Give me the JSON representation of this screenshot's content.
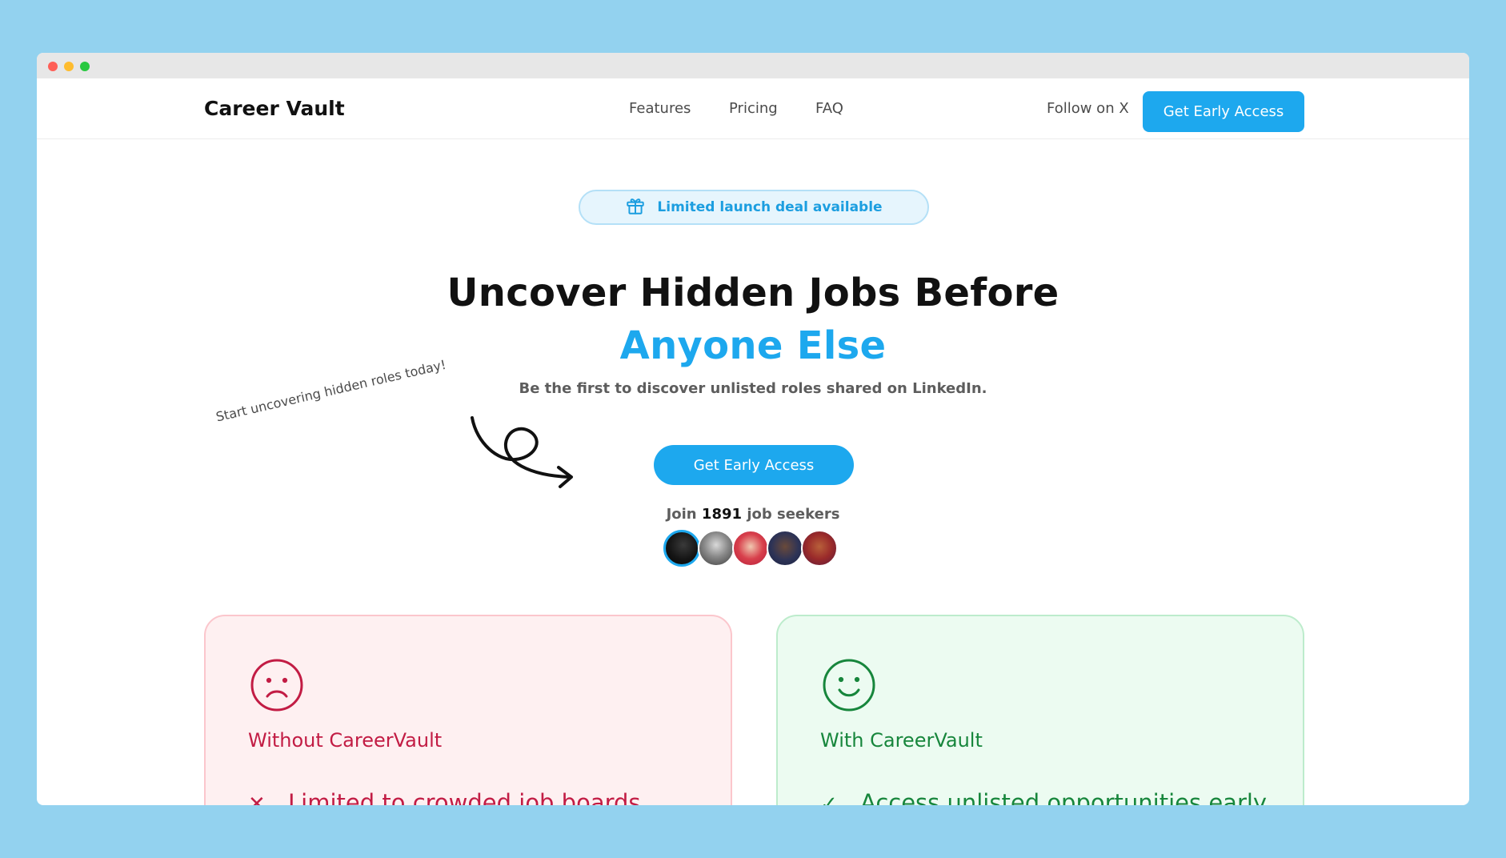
{
  "nav": {
    "brand": "Career Vault",
    "links": [
      "Features",
      "Pricing",
      "FAQ"
    ],
    "follow": "Follow on X",
    "cta": "Get Early Access"
  },
  "hero": {
    "badge_icon": "gift-icon",
    "badge": "Limited launch deal available",
    "title_line1": "Uncover Hidden Jobs Before",
    "title_line2": "Anyone Else",
    "subtitle": "Be the first to discover unlisted roles shared on LinkedIn.",
    "cta": "Get Early Access",
    "join_prefix": "Join",
    "join_count": "1891",
    "join_suffix": "job seekers",
    "scribble": "Start uncovering hidden roles today!"
  },
  "comparison": {
    "without": {
      "icon": "sad-face-icon",
      "title": "Without CareerVault",
      "item_mark": "✕",
      "item": "Limited to crowded job boards"
    },
    "with": {
      "icon": "happy-face-icon",
      "title": "With CareerVault",
      "item_mark": "✓",
      "item": "Access unlisted opportunities early"
    }
  },
  "colors": {
    "accent": "#1da8ee",
    "bad": "#c21c44",
    "good": "#17863c",
    "background": "#93d2ef"
  }
}
